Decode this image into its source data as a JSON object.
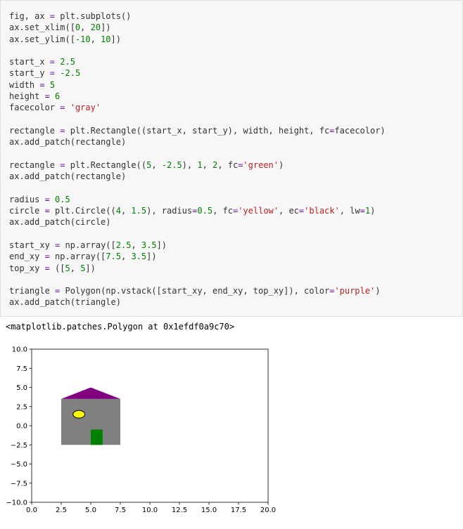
{
  "code_cell": {
    "lines": [
      [
        {
          "t": "fig, ax "
        },
        {
          "t": "=",
          "c": "op"
        },
        {
          "t": " plt.subplots()"
        }
      ],
      [
        {
          "t": "ax.set_xlim(["
        },
        {
          "t": "0",
          "c": "num"
        },
        {
          "t": ", "
        },
        {
          "t": "20",
          "c": "num"
        },
        {
          "t": "])"
        }
      ],
      [
        {
          "t": "ax.set_ylim(["
        },
        {
          "t": "-10",
          "c": "num"
        },
        {
          "t": ", "
        },
        {
          "t": "10",
          "c": "num"
        },
        {
          "t": "])"
        }
      ],
      [],
      [
        {
          "t": "start_x "
        },
        {
          "t": "=",
          "c": "op"
        },
        {
          "t": " "
        },
        {
          "t": "2.5",
          "c": "num"
        }
      ],
      [
        {
          "t": "start_y "
        },
        {
          "t": "=",
          "c": "op"
        },
        {
          "t": " "
        },
        {
          "t": "-2.5",
          "c": "num"
        }
      ],
      [
        {
          "t": "width "
        },
        {
          "t": "=",
          "c": "op"
        },
        {
          "t": " "
        },
        {
          "t": "5",
          "c": "num"
        }
      ],
      [
        {
          "t": "height "
        },
        {
          "t": "=",
          "c": "op"
        },
        {
          "t": " "
        },
        {
          "t": "6",
          "c": "num"
        }
      ],
      [
        {
          "t": "facecolor "
        },
        {
          "t": "=",
          "c": "op"
        },
        {
          "t": " "
        },
        {
          "t": "'gray'",
          "c": "str"
        }
      ],
      [],
      [
        {
          "t": "rectangle "
        },
        {
          "t": "=",
          "c": "op"
        },
        {
          "t": " plt.Rectangle((start_x, start_y), width, height, fc"
        },
        {
          "t": "=",
          "c": "op"
        },
        {
          "t": "facecolor)"
        }
      ],
      [
        {
          "t": "ax.add_patch(rectangle)"
        }
      ],
      [],
      [
        {
          "t": "rectangle "
        },
        {
          "t": "=",
          "c": "op"
        },
        {
          "t": " plt.Rectangle(("
        },
        {
          "t": "5",
          "c": "num"
        },
        {
          "t": ", "
        },
        {
          "t": "-2.5",
          "c": "num"
        },
        {
          "t": "), "
        },
        {
          "t": "1",
          "c": "num"
        },
        {
          "t": ", "
        },
        {
          "t": "2",
          "c": "num"
        },
        {
          "t": ", fc"
        },
        {
          "t": "=",
          "c": "op"
        },
        {
          "t": "'green'",
          "c": "str"
        },
        {
          "t": ")"
        }
      ],
      [
        {
          "t": "ax.add_patch(rectangle)"
        }
      ],
      [],
      [
        {
          "t": "radius "
        },
        {
          "t": "=",
          "c": "op"
        },
        {
          "t": " "
        },
        {
          "t": "0.5",
          "c": "num"
        }
      ],
      [
        {
          "t": "circle "
        },
        {
          "t": "=",
          "c": "op"
        },
        {
          "t": " plt.Circle(("
        },
        {
          "t": "4",
          "c": "num"
        },
        {
          "t": ", "
        },
        {
          "t": "1.5",
          "c": "num"
        },
        {
          "t": "), radius"
        },
        {
          "t": "=",
          "c": "op"
        },
        {
          "t": "0.5",
          "c": "num"
        },
        {
          "t": ", fc"
        },
        {
          "t": "=",
          "c": "op"
        },
        {
          "t": "'yellow'",
          "c": "str"
        },
        {
          "t": ", ec"
        },
        {
          "t": "=",
          "c": "op"
        },
        {
          "t": "'black'",
          "c": "str"
        },
        {
          "t": ", lw"
        },
        {
          "t": "=",
          "c": "op"
        },
        {
          "t": "1",
          "c": "num"
        },
        {
          "t": ")"
        }
      ],
      [
        {
          "t": "ax.add_patch(circle)"
        }
      ],
      [],
      [
        {
          "t": "start_xy "
        },
        {
          "t": "=",
          "c": "op"
        },
        {
          "t": " np.array(["
        },
        {
          "t": "2.5",
          "c": "num"
        },
        {
          "t": ", "
        },
        {
          "t": "3.5",
          "c": "num"
        },
        {
          "t": "])"
        }
      ],
      [
        {
          "t": "end_xy "
        },
        {
          "t": "=",
          "c": "op"
        },
        {
          "t": " np.array(["
        },
        {
          "t": "7.5",
          "c": "num"
        },
        {
          "t": ", "
        },
        {
          "t": "3.5",
          "c": "num"
        },
        {
          "t": "])"
        }
      ],
      [
        {
          "t": "top_xy "
        },
        {
          "t": "=",
          "c": "op"
        },
        {
          "t": " (["
        },
        {
          "t": "5",
          "c": "num"
        },
        {
          "t": ", "
        },
        {
          "t": "5",
          "c": "num"
        },
        {
          "t": "])"
        }
      ],
      [],
      [
        {
          "t": "triangle "
        },
        {
          "t": "=",
          "c": "op"
        },
        {
          "t": " Polygon(np.vstack([start_xy, end_xy, top_xy]), color"
        },
        {
          "t": "=",
          "c": "op"
        },
        {
          "t": "'purple'",
          "c": "str"
        },
        {
          "t": ")"
        }
      ],
      [
        {
          "t": "ax.add_patch(triangle)"
        }
      ]
    ]
  },
  "output": {
    "text": "<matplotlib.patches.Polygon at 0x1efdf0a9c70>"
  },
  "chart_data": {
    "type": "patches",
    "xlim": [
      0,
      20
    ],
    "ylim": [
      -10,
      10
    ],
    "x_ticks": [
      0,
      2.5,
      5,
      7.5,
      10,
      12.5,
      15,
      17.5,
      20
    ],
    "y_ticks": [
      -10,
      -7.5,
      -5,
      -2.5,
      0,
      2.5,
      5,
      7.5,
      10
    ],
    "x_tick_labels": [
      "0.0",
      "2.5",
      "5.0",
      "7.5",
      "10.0",
      "12.5",
      "15.0",
      "17.5",
      "20.0"
    ],
    "y_tick_labels": [
      "−10.0",
      "−7.5",
      "−5.0",
      "−2.5",
      "0.0",
      "2.5",
      "5.0",
      "7.5",
      "10.0"
    ],
    "grid": false,
    "patches": [
      {
        "kind": "rectangle",
        "xy": [
          2.5,
          -2.5
        ],
        "width": 5,
        "height": 6,
        "fc": "#808080"
      },
      {
        "kind": "rectangle",
        "xy": [
          5,
          -2.5
        ],
        "width": 1,
        "height": 2,
        "fc": "#008000"
      },
      {
        "kind": "circle",
        "center": [
          4,
          1.5
        ],
        "radius": 0.5,
        "fc": "#ffff00",
        "ec": "#000000",
        "lw": 1
      },
      {
        "kind": "polygon",
        "points": [
          [
            2.5,
            3.5
          ],
          [
            7.5,
            3.5
          ],
          [
            5,
            5
          ]
        ],
        "fc": "#800080"
      }
    ]
  }
}
